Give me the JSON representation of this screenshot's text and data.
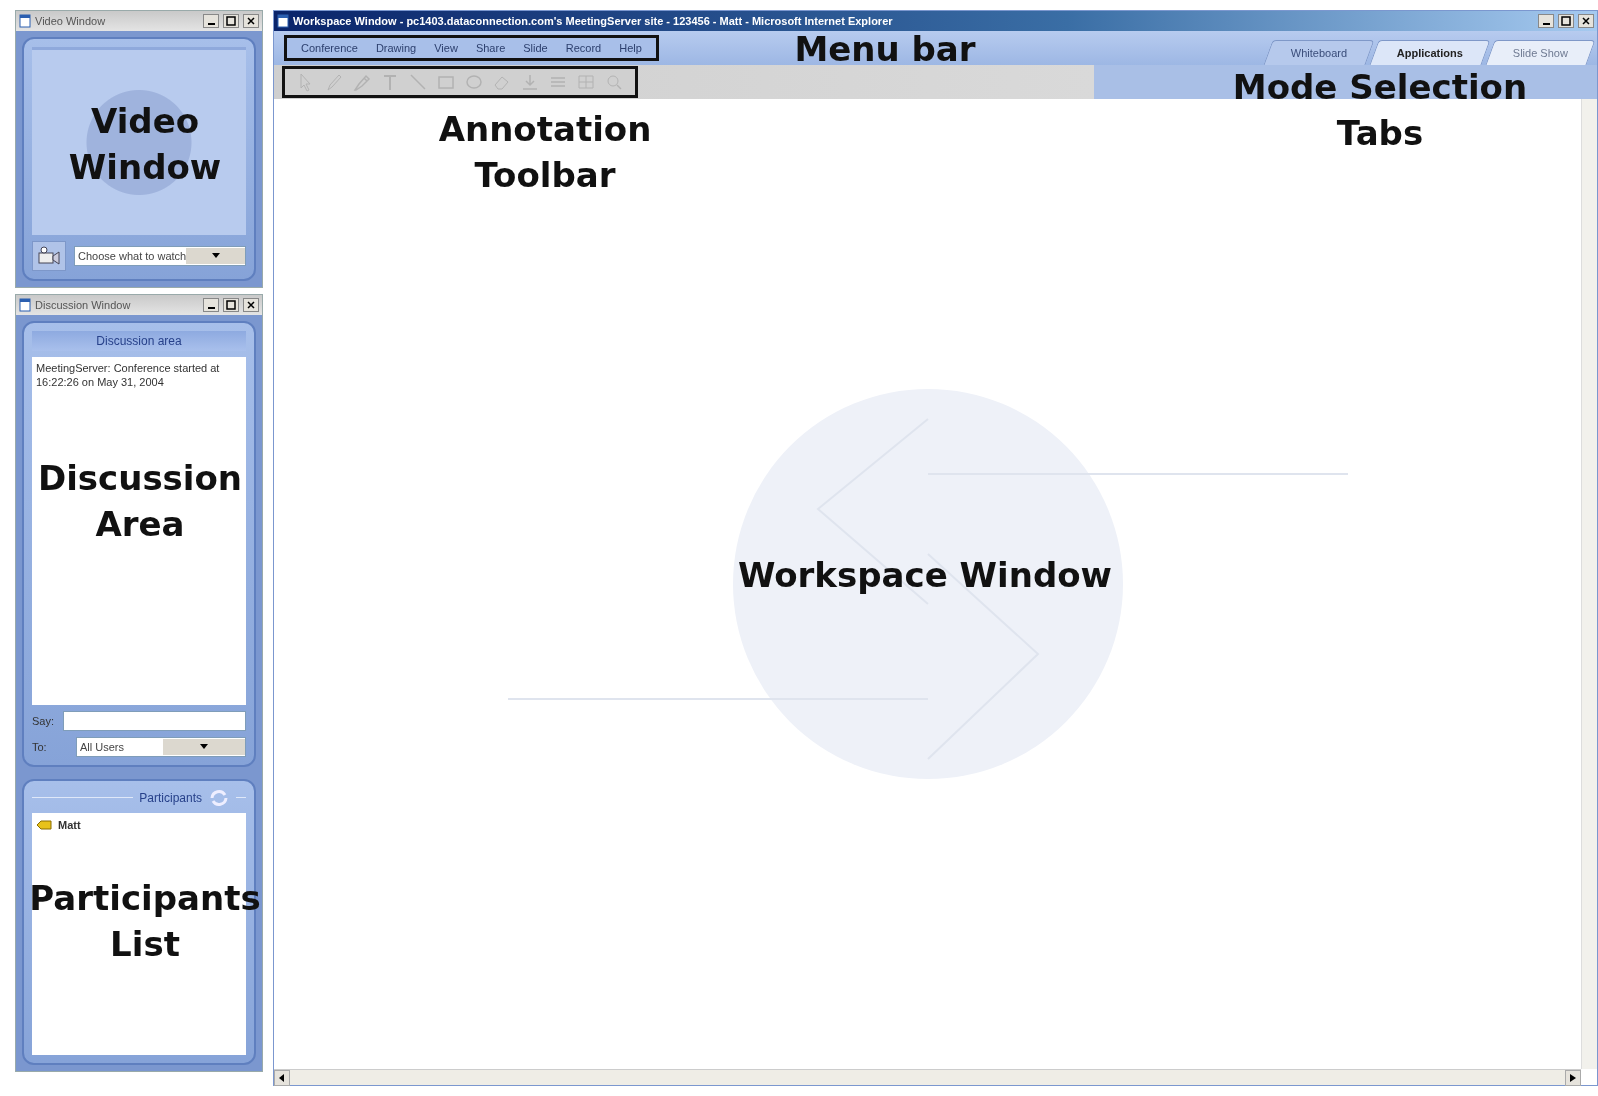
{
  "video_window": {
    "title": "Video Window",
    "source_select": {
      "value": "Choose what to watch"
    }
  },
  "discussion_window": {
    "title": "Discussion Window",
    "header": "Discussion area",
    "messages": [
      "MeetingServer: Conference started at 16:22:26 on May 31, 2004"
    ],
    "say_label": "Say:",
    "to_label": "To:",
    "to_select": {
      "value": "All Users"
    }
  },
  "participants": {
    "header": "Participants",
    "items": [
      {
        "name": "Matt"
      }
    ]
  },
  "workspace_window": {
    "title": "Workspace Window - pc1403.dataconnection.com's MeetingServer site - 123456 - Matt - Microsoft Internet Explorer",
    "menu": [
      "Conference",
      "Drawing",
      "View",
      "Share",
      "Slide",
      "Record",
      "Help"
    ],
    "tabs": [
      {
        "label": "Whiteboard",
        "selected": false,
        "disabled": false
      },
      {
        "label": "Applications",
        "selected": true,
        "disabled": false
      },
      {
        "label": "Slide Show",
        "selected": false,
        "disabled": true
      }
    ],
    "tools": [
      {
        "kind": "pointer",
        "disabled": true
      },
      {
        "kind": "pen",
        "disabled": true
      },
      {
        "kind": "highlighter",
        "disabled": true
      },
      {
        "kind": "text",
        "disabled": true
      },
      {
        "kind": "line",
        "disabled": true
      },
      {
        "kind": "rectangle",
        "disabled": true
      },
      {
        "kind": "ellipse",
        "disabled": true
      },
      {
        "kind": "eraser",
        "disabled": true
      },
      {
        "kind": "import",
        "disabled": true
      },
      {
        "kind": "list",
        "disabled": true
      },
      {
        "kind": "grid",
        "disabled": true
      },
      {
        "kind": "zoom",
        "disabled": true
      }
    ]
  },
  "annotations": [
    {
      "kind": "video",
      "text": "Video Window"
    },
    {
      "kind": "menu",
      "text": "Menu bar"
    },
    {
      "kind": "tabs",
      "text": "Mode Selection Tabs"
    },
    {
      "kind": "toolbar",
      "text": "Annotation Toolbar"
    },
    {
      "kind": "discussion",
      "text": "Discussion Area"
    },
    {
      "kind": "workspace",
      "text": "Workspace Window"
    },
    {
      "kind": "participants",
      "text": "Participants List"
    }
  ]
}
